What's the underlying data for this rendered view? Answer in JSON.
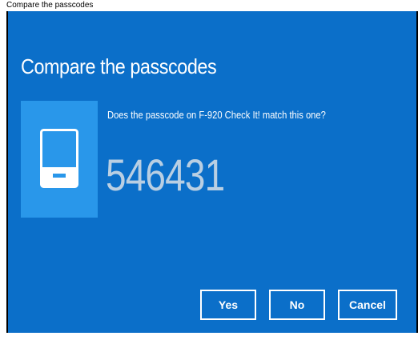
{
  "window": {
    "title": "Compare the passcodes"
  },
  "dialog": {
    "heading": "Compare the passcodes",
    "question": "Does the passcode on F-920 Check It! match this one?",
    "passcode": "546431",
    "device_icon": "phone-icon",
    "colors": {
      "background": "#0b6fc9",
      "tile": "#2997ea",
      "passcode_text": "#b9cfe3",
      "text": "#ffffff"
    }
  },
  "buttons": {
    "yes_label": "Yes",
    "no_label": "No",
    "cancel_label": "Cancel"
  }
}
